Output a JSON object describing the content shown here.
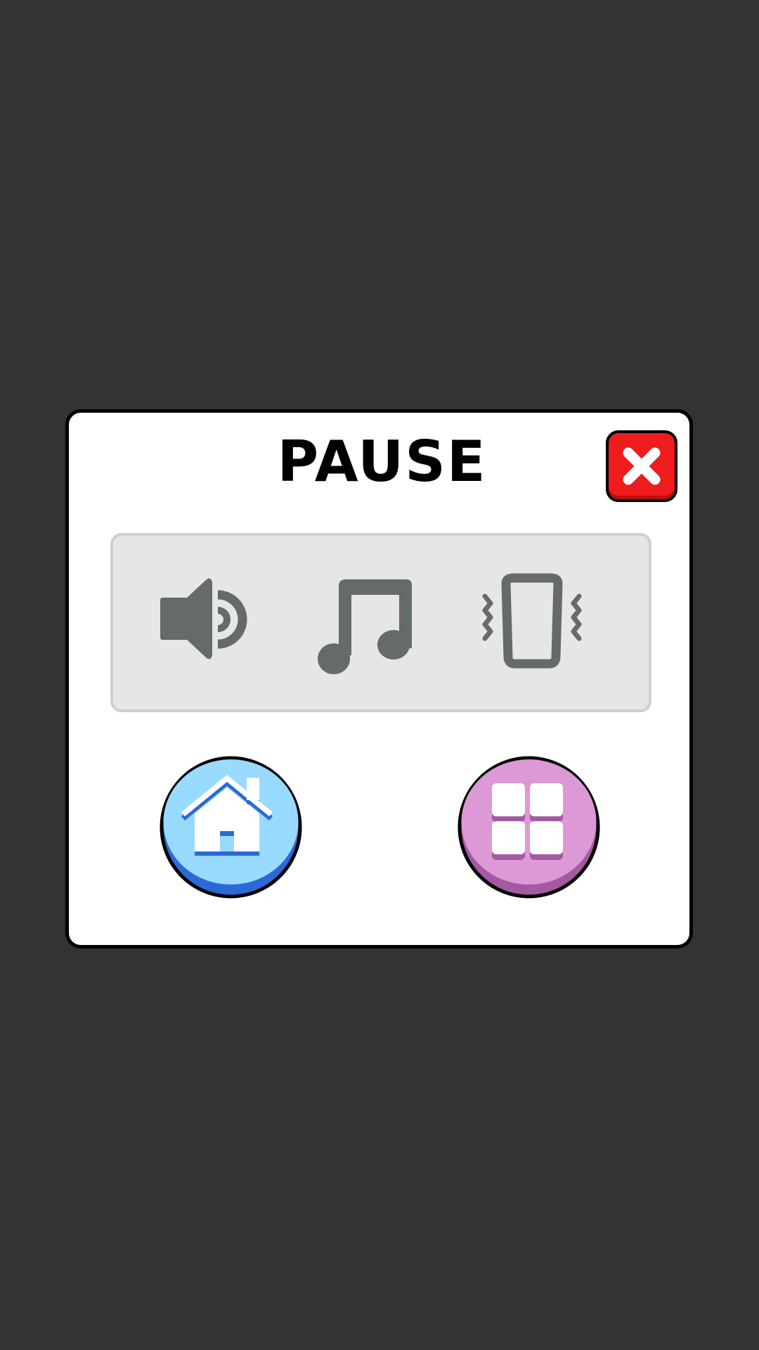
{
  "dialog": {
    "title": "PAUSE"
  },
  "close_button": {
    "icon": "close-icon",
    "color": "#ee1c1c"
  },
  "settings": {
    "toggles": [
      {
        "icon": "speaker-icon",
        "meaning": "sound",
        "enabled": true
      },
      {
        "icon": "music-note-icon",
        "meaning": "music",
        "enabled": true
      },
      {
        "icon": "vibration-icon",
        "meaning": "vibration",
        "enabled": true
      }
    ],
    "icon_color": "#656a6b",
    "panel_color": "#e6e6e6"
  },
  "actions": [
    {
      "icon": "home-icon",
      "color": "#99daff",
      "shade": "#2a6ad6"
    },
    {
      "icon": "grid-icon",
      "color": "#dd98d6",
      "shade": "#a45aa3"
    }
  ],
  "colors": {
    "background": "#333333",
    "panel": "#ffffff",
    "outline": "#000000"
  }
}
